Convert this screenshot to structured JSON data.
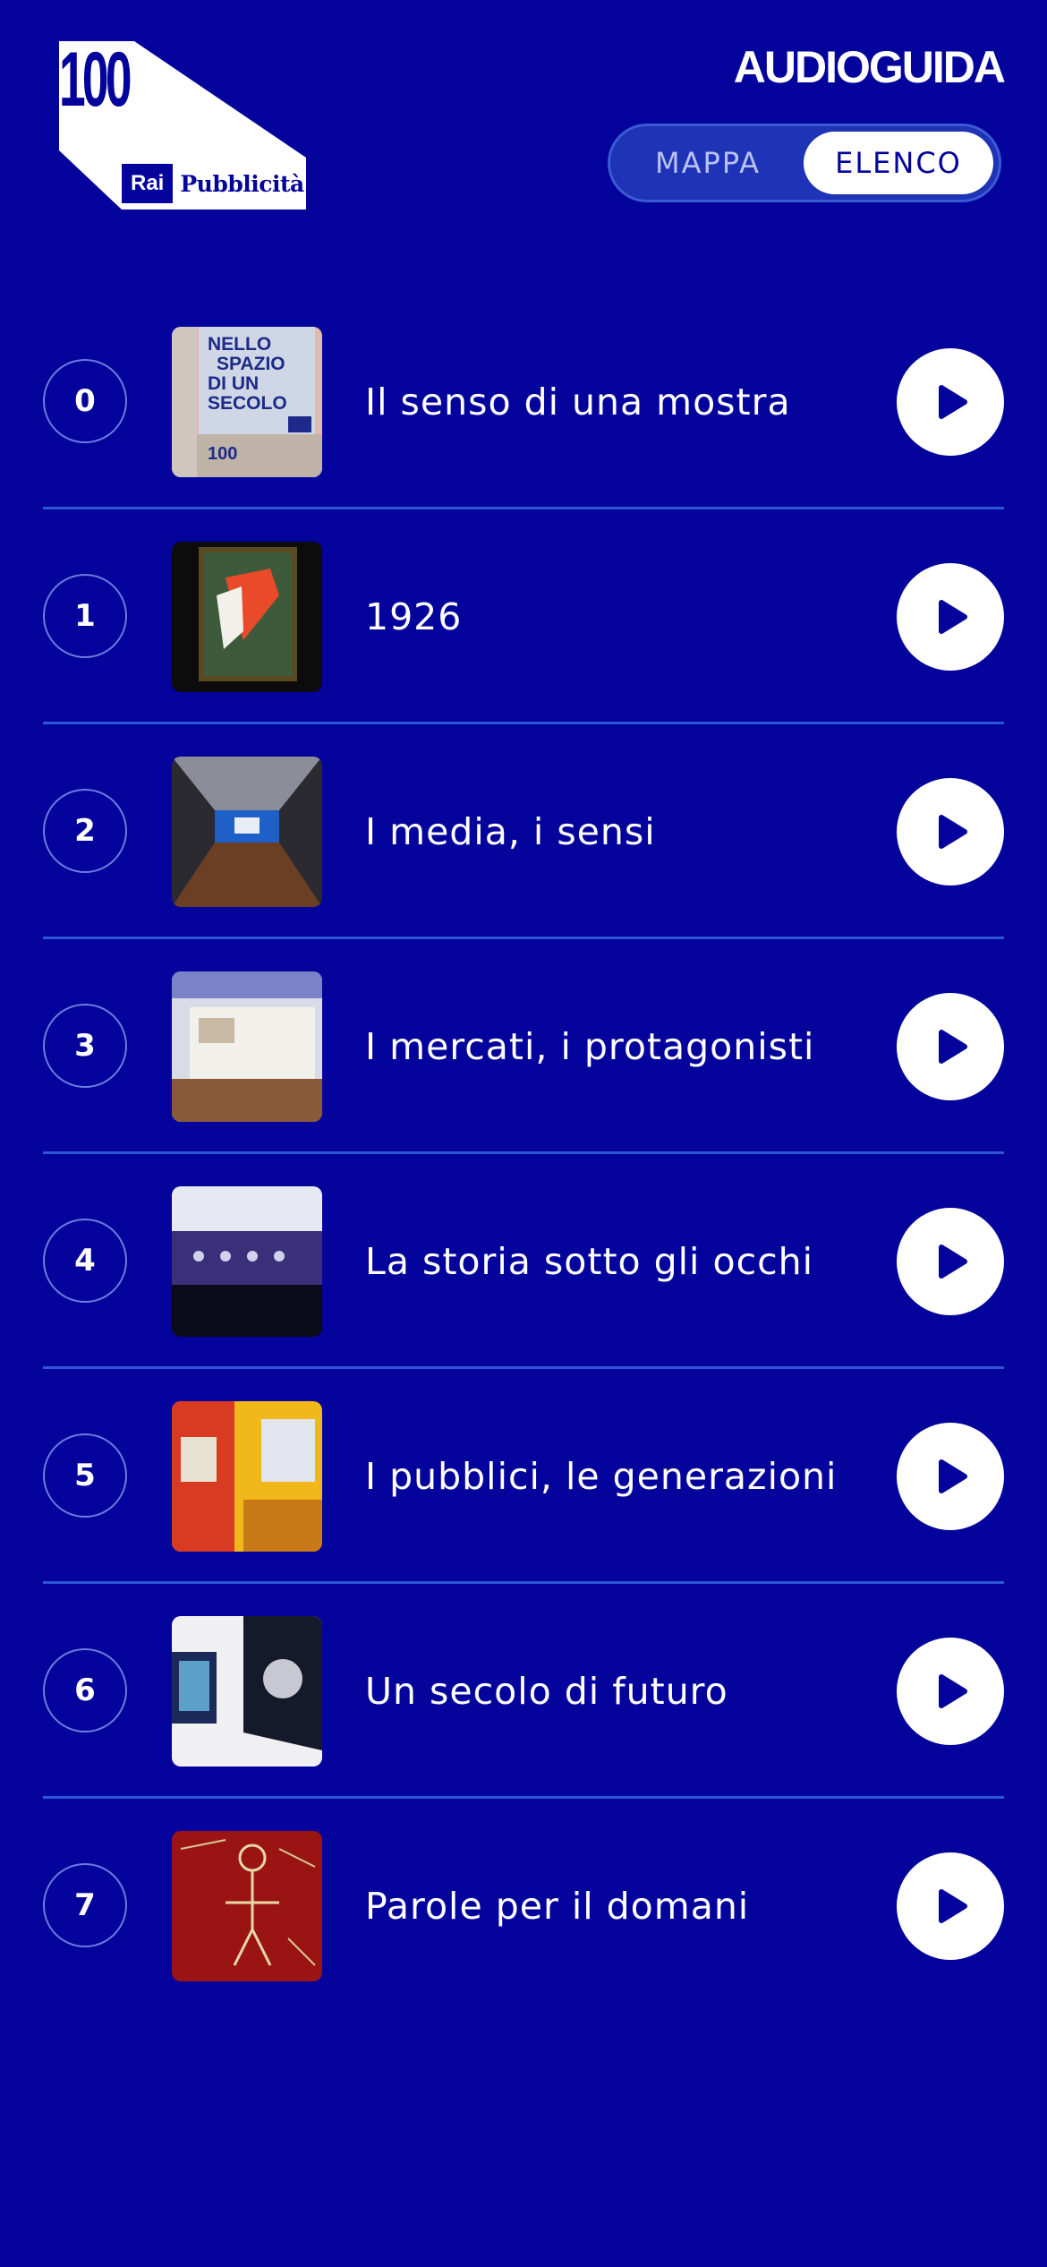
{
  "logo": {
    "number": "100",
    "badge_rai": "Rai",
    "badge_text": "Pubblicità"
  },
  "header": {
    "title": "AUDIOGUIDA"
  },
  "view_toggle": {
    "options": [
      {
        "label": "MAPPA",
        "selected": false
      },
      {
        "label": "ELENCO",
        "selected": true
      }
    ]
  },
  "stops": [
    {
      "number": "0",
      "title": "Il senso di una mostra"
    },
    {
      "number": "1",
      "title": "1926"
    },
    {
      "number": "2",
      "title": "I media, i sensi"
    },
    {
      "number": "3",
      "title": "I mercati, i protagonisti"
    },
    {
      "number": "4",
      "title": "La storia sotto gli occhi"
    },
    {
      "number": "5",
      "title": "I pubblici, le generazioni"
    },
    {
      "number": "6",
      "title": "Un secolo di futuro"
    },
    {
      "number": "7",
      "title": "Parole per il domani"
    }
  ],
  "thumbnails": {
    "0": {
      "text_lines": [
        "NELLO",
        "SPAZIO",
        "DI UN",
        "SECOLO",
        "100"
      ]
    }
  },
  "icons": {
    "play": "play-icon"
  },
  "colors": {
    "background": "#04039B",
    "divider": "#2E56D6",
    "accent": "#FFFFFF"
  }
}
